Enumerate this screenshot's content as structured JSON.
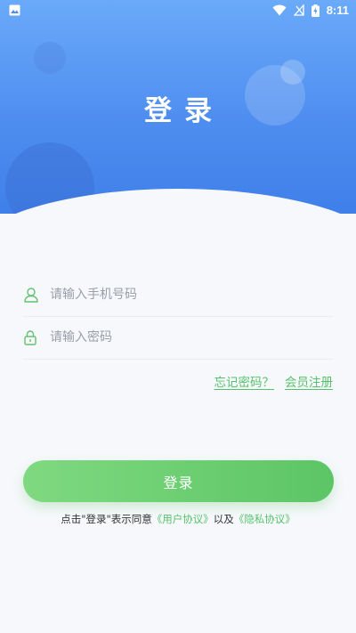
{
  "status_bar": {
    "time": "8:11",
    "icons": [
      "image-icon",
      "wifi-icon",
      "no-signal-icon",
      "battery-charging-icon"
    ]
  },
  "header": {
    "title": "登录"
  },
  "form": {
    "phone": {
      "placeholder": "请输入手机号码",
      "icon": "user-icon"
    },
    "password": {
      "placeholder": "请输入密码",
      "icon": "lock-icon"
    }
  },
  "links": {
    "forgot": "忘记密码？",
    "register": "会员注册"
  },
  "login_button": "登录",
  "agreement": {
    "prefix": "点击\"登录\"表示同意",
    "user_agreement": "《用户协议》",
    "middle": "以及",
    "privacy": "《隐私协议》"
  },
  "colors": {
    "header_top": "#6aaaf9",
    "header_bottom": "#3f7fe9",
    "accent_green": "#55c26b"
  }
}
